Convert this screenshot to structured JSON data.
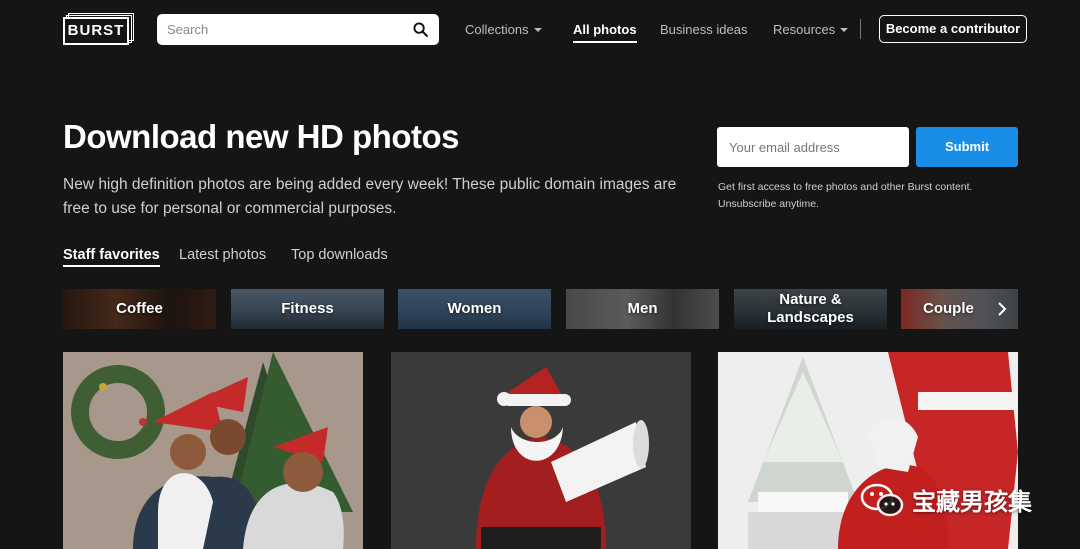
{
  "brand": {
    "logo_text": "BURST"
  },
  "search": {
    "placeholder": "Search"
  },
  "nav": {
    "collections": "Collections",
    "all_photos": "All photos",
    "business_ideas": "Business ideas",
    "resources": "Resources",
    "contributor": "Become a contributor"
  },
  "hero": {
    "title": "Download new HD photos",
    "description": "New high definition photos are being added every week! These public domain images are free to use for personal or commercial purposes."
  },
  "signup": {
    "email_placeholder": "Your email address",
    "submit_label": "Submit",
    "note": "Get first access to free photos and other Burst content. Unsubscribe anytime."
  },
  "tabs": [
    "Staff favorites",
    "Latest photos",
    "Top downloads"
  ],
  "categories": [
    "Coffee",
    "Fitness",
    "Women",
    "Men",
    "Nature & Landscapes",
    "Couple"
  ],
  "watermark": "宝藏男孩集",
  "colors": {
    "background": "#151515",
    "accent": "#1a8de6"
  }
}
